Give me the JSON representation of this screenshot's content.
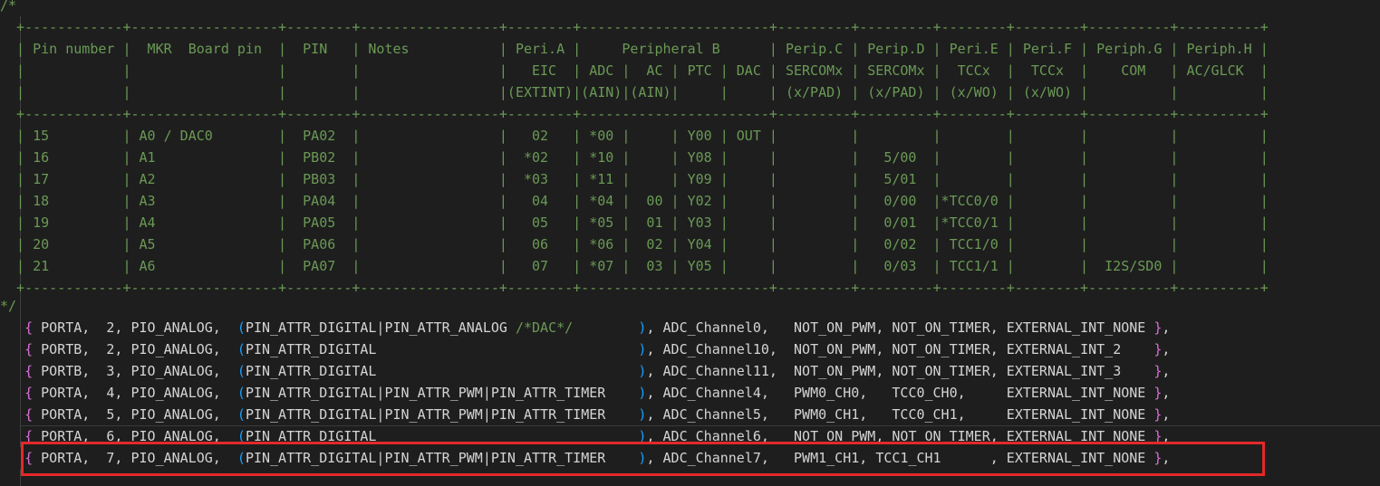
{
  "colors": {
    "background": "#1e1e1e",
    "comment": "#6a9955",
    "code": "#d4d4d4",
    "bracket": "#da70d6",
    "paren": "#179fff",
    "highlight": "#e32929"
  },
  "comment_lines": [
    "/*",
    "  +------------+------------------+--------+-----------------+--------+-----------------------+---------+---------+--------+--------+----------+----------+",
    "  | Pin number |  MKR  Board pin  |  PIN   | Notes           | Peri.A |     Peripheral B      | Perip.C | Perip.D | Peri.E | Peri.F | Periph.G | Periph.H |",
    "  |            |                  |        |                 |   EIC  | ADC |  AC | PTC | DAC | SERCOMx | SERCOMx |  TCCx  |  TCCx  |    COM   | AC/GLCK  |",
    "  |            |                  |        |                 |(EXTINT)|(AIN)|(AIN)|     |     | (x/PAD) | (x/PAD) | (x/WO) | (x/WO) |          |          |",
    "  +------------+------------------+--------+-----------------+--------+-----------------------+---------+---------+--------+--------+----------+----------+",
    "  | 15         | A0 / DAC0        |  PA02  |                 |   02   | *00 |     | Y00 | OUT |         |         |        |        |          |          |",
    "  | 16         | A1               |  PB02  |                 |  *02   | *10 |     | Y08 |     |         |   5/00  |        |        |          |          |",
    "  | 17         | A2               |  PB03  |                 |  *03   | *11 |     | Y09 |     |         |   5/01  |        |        |          |          |",
    "  | 18         | A3               |  PA04  |                 |   04   | *04 |  00 | Y02 |     |         |   0/00  |*TCC0/0 |        |          |          |",
    "  | 19         | A4               |  PA05  |                 |   05   | *05 |  01 | Y03 |     |         |   0/01  |*TCC0/1 |        |          |          |",
    "  | 20         | A5               |  PA06  |                 |   06   | *06 |  02 | Y04 |     |         |   0/02  | TCC1/0 |        |          |          |",
    "  | 21         | A6               |  PA07  |                 |   07   | *07 |  03 | Y05 |     |         |   0/03  | TCC1/1 |        |  I2S/SD0 |          |",
    "  +------------+------------------+--------+-----------------+--------+-----------------------+---------+---------+--------+--------+----------+----------+",
    "*/"
  ],
  "code_lines": [
    {
      "pre": "   ",
      "open": "{",
      "a": " PORTA,  2, PIO_ANALOG,  ",
      "lp": "(",
      "b": "PIN_ATTR_DIGITAL|PIN_ATTR_ANALOG ",
      "cm": "/*DAC*/",
      "c": "        ",
      "rp": ")",
      "d": ", ADC_Channel0,   NOT_ON_PWM, NOT_ON_TIMER, EXTERNAL_INT_NONE ",
      "close": "}",
      "e": ","
    },
    {
      "pre": "   ",
      "open": "{",
      "a": " PORTB,  2, PIO_ANALOG,  ",
      "lp": "(",
      "b": "PIN_ATTR_DIGITAL",
      "cm": "",
      "c": "                                ",
      "rp": ")",
      "d": ", ADC_Channel10,  NOT_ON_PWM, NOT_ON_TIMER, EXTERNAL_INT_2    ",
      "close": "}",
      "e": ","
    },
    {
      "pre": "   ",
      "open": "{",
      "a": " PORTB,  3, PIO_ANALOG,  ",
      "lp": "(",
      "b": "PIN_ATTR_DIGITAL",
      "cm": "",
      "c": "                                ",
      "rp": ")",
      "d": ", ADC_Channel11,  NOT_ON_PWM, NOT_ON_TIMER, EXTERNAL_INT_3    ",
      "close": "}",
      "e": ","
    },
    {
      "pre": "   ",
      "open": "{",
      "a": " PORTA,  4, PIO_ANALOG,  ",
      "lp": "(",
      "b": "PIN_ATTR_DIGITAL|PIN_ATTR_PWM|PIN_ATTR_TIMER",
      "cm": "",
      "c": "    ",
      "rp": ")",
      "d": ", ADC_Channel4,   PWM0_CH0,   TCC0_CH0,     EXTERNAL_INT_NONE ",
      "close": "}",
      "e": ","
    },
    {
      "pre": "   ",
      "open": "{",
      "a": " PORTA,  5, PIO_ANALOG,  ",
      "lp": "(",
      "b": "PIN_ATTR_DIGITAL|PIN_ATTR_PWM|PIN_ATTR_TIMER",
      "cm": "",
      "c": "    ",
      "rp": ")",
      "d": ", ADC_Channel5,   PWM0_CH1,   TCC0_CH1,     EXTERNAL_INT_NONE ",
      "close": "}",
      "e": ","
    },
    {
      "pre": "   ",
      "open": "{",
      "a": " PORTA,  6, PIO_ANALOG,  ",
      "lp": "(",
      "b": "PIN_ATTR_DIGITAL",
      "cm": "",
      "c": "                                ",
      "rp": ")",
      "d": ", ADC_Channel6,   NOT_ON_PWM, NOT_ON_TIMER, EXTERNAL_INT_NONE ",
      "close": "}",
      "e": ","
    },
    {
      "pre": "   ",
      "open": "{",
      "a": " PORTA,  7, PIO_ANALOG,  ",
      "lp": "(",
      "b": "PIN_ATTR_DIGITAL|PIN_ATTR_PWM|PIN_ATTR_TIMER",
      "cm": "",
      "c": "    ",
      "rp": ")",
      "d": ", ADC_Channel7,   PWM1_CH1, TCC1_CH1      , EXTERNAL_INT_NONE ",
      "close": "}",
      "e": ","
    }
  ]
}
